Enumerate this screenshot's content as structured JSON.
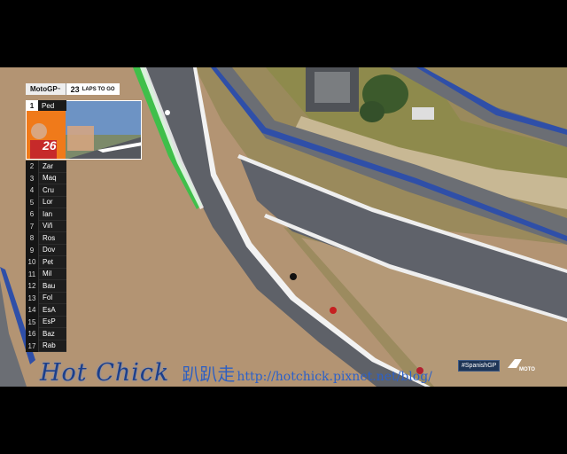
{
  "broadcast": {
    "series_label": "MotoGP",
    "series_trademark": "™",
    "laps_to_go_number": "23",
    "laps_to_go_text": "LAPS TO GO",
    "hashtag": "#SpanishGP"
  },
  "leader": {
    "position": "1",
    "name": "Ped",
    "rider_number": "26"
  },
  "standings": [
    {
      "pos": "2",
      "name": "Zar"
    },
    {
      "pos": "3",
      "name": "Maq"
    },
    {
      "pos": "4",
      "name": "Cru"
    },
    {
      "pos": "5",
      "name": "Lor"
    },
    {
      "pos": "6",
      "name": "Ian"
    },
    {
      "pos": "7",
      "name": "Viñ"
    },
    {
      "pos": "8",
      "name": "Ros"
    },
    {
      "pos": "9",
      "name": "Dov"
    },
    {
      "pos": "10",
      "name": "Pet"
    },
    {
      "pos": "11",
      "name": "Mil"
    },
    {
      "pos": "12",
      "name": "Bau"
    },
    {
      "pos": "13",
      "name": "Fol"
    },
    {
      "pos": "14",
      "name": "EsA"
    },
    {
      "pos": "15",
      "name": "EsP"
    },
    {
      "pos": "16",
      "name": "Baz"
    },
    {
      "pos": "17",
      "name": "Rab"
    }
  ],
  "watermark": {
    "script": "Hot Chick",
    "chinese": "趴趴走",
    "url": "http://hotchick.pixnet.net/blog/"
  },
  "colors": {
    "track_asphalt": "#5e6168",
    "gravel": "#b39473",
    "grass": "#8f8b4a",
    "kerb_green": "#3fbf4a",
    "barrier_blue": "#2f4fa8",
    "overlay_dark": "#1d1d1d",
    "hashtag_bg": "#1e3556",
    "leader_orange": "#f07a1a"
  }
}
